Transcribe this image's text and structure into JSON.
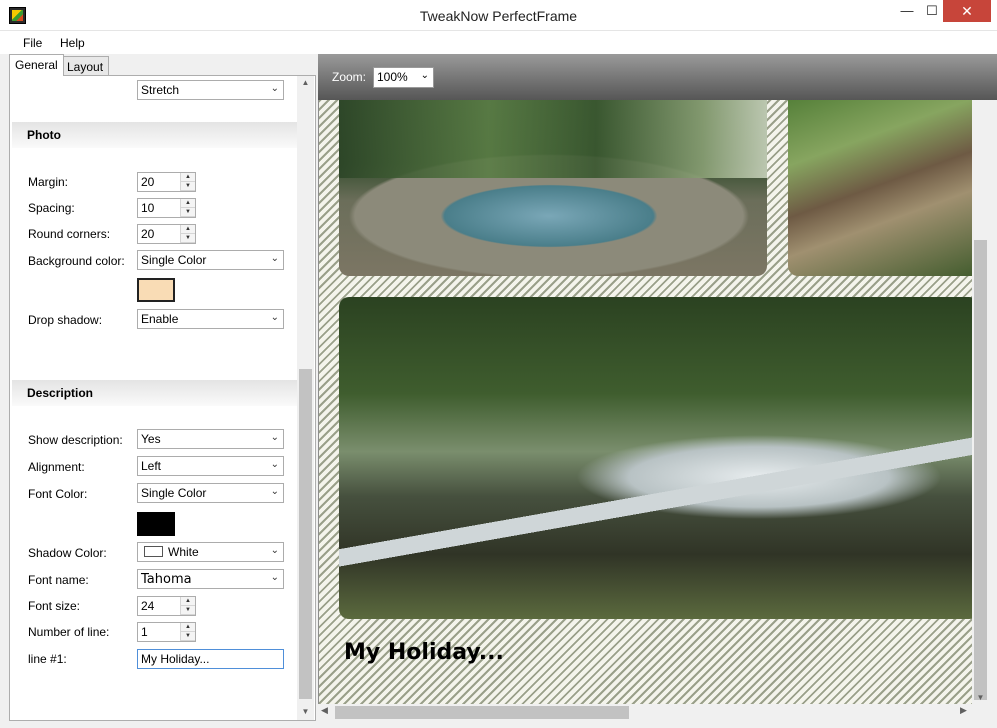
{
  "window": {
    "title": "TweakNow PerfectFrame",
    "minimize": "—",
    "maximize": "☐",
    "close": "✕"
  },
  "menu": {
    "file": "File",
    "help": "Help"
  },
  "tabs": {
    "general": "General",
    "layout": "Layout"
  },
  "top_combo": {
    "value": "Stretch"
  },
  "photo_section": {
    "title": "Photo",
    "margin_label": "Margin:",
    "margin_value": "20",
    "spacing_label": "Spacing:",
    "spacing_value": "10",
    "round_label": "Round corners:",
    "round_value": "20",
    "bg_color_label": "Background color:",
    "bg_color_value": "Single Color",
    "bg_swatch_color": "#f9dcb5",
    "drop_shadow_label": "Drop shadow:",
    "drop_shadow_value": "Enable"
  },
  "description_section": {
    "title": "Description",
    "show_label": "Show description:",
    "show_value": "Yes",
    "align_label": "Alignment:",
    "align_value": "Left",
    "font_color_label": "Font Color:",
    "font_color_value": "Single Color",
    "font_swatch_color": "#000000",
    "shadow_label": "Shadow Color:",
    "shadow_value": "White",
    "font_name_label": "Font name:",
    "font_name_value": "Tahoma",
    "font_size_label": "Font size:",
    "font_size_value": "24",
    "lines_label": "Number of line:",
    "lines_value": "1",
    "line1_label": "line #1:",
    "line1_value": "My Holiday..."
  },
  "preview": {
    "zoom_label": "Zoom:",
    "zoom_value": "100%",
    "caption": "My Holiday..."
  }
}
